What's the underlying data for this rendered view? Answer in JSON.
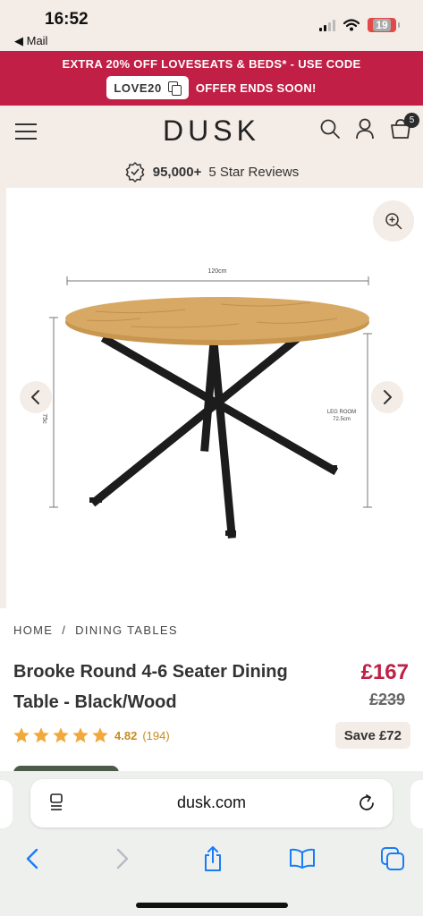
{
  "status_bar": {
    "time": "16:52",
    "back_label": "◀ Mail",
    "battery": "19",
    "colors": {
      "battery_low": "#e24a4a"
    }
  },
  "promo": {
    "line1": "EXTRA 20% OFF LOVESEATS & BEDS* - USE CODE",
    "code": "LOVE20",
    "line2_suffix": "OFFER ENDS SOON!",
    "colors": {
      "background": "#c11f45",
      "text": "#ffffff"
    }
  },
  "header": {
    "logo": "DUSK",
    "cart_count": "5",
    "icons": [
      "menu-icon",
      "search-icon",
      "account-icon",
      "cart-icon"
    ],
    "reviews": {
      "count": "95,000+",
      "label": "5 Star Reviews",
      "icon": "review-badge-icon"
    },
    "colors": {
      "background": "#f4ece6"
    }
  },
  "gallery": {
    "icons": [
      "zoom-icon",
      "chevron-left-icon",
      "chevron-right-icon"
    ],
    "product_image": {
      "width_label": "120cm",
      "height_label": "75c",
      "leg_room_label": "LEG ROOM",
      "leg_room_value": "72.5cm"
    }
  },
  "breadcrumb": {
    "items": [
      "HOME",
      "DINING TABLES"
    ],
    "separator": "/"
  },
  "product": {
    "title": "Brooke Round 4-6 Seater Dining Table - Black/Wood",
    "price": "£167",
    "old_price": "£239",
    "rating": {
      "value": "4.82",
      "count": "(194)",
      "stars": 5
    },
    "save": "Save £72",
    "colors": {
      "price": "#c11f45",
      "rating": "#c78b1f",
      "stars": "#f2a93b"
    }
  },
  "safari": {
    "domain": "dusk.com",
    "icons": [
      "reader-icon",
      "reload-icon",
      "back-icon",
      "forward-icon",
      "share-icon",
      "bookmarks-icon",
      "tabs-icon"
    ],
    "colors": {
      "accent": "#1a7cf5"
    }
  }
}
